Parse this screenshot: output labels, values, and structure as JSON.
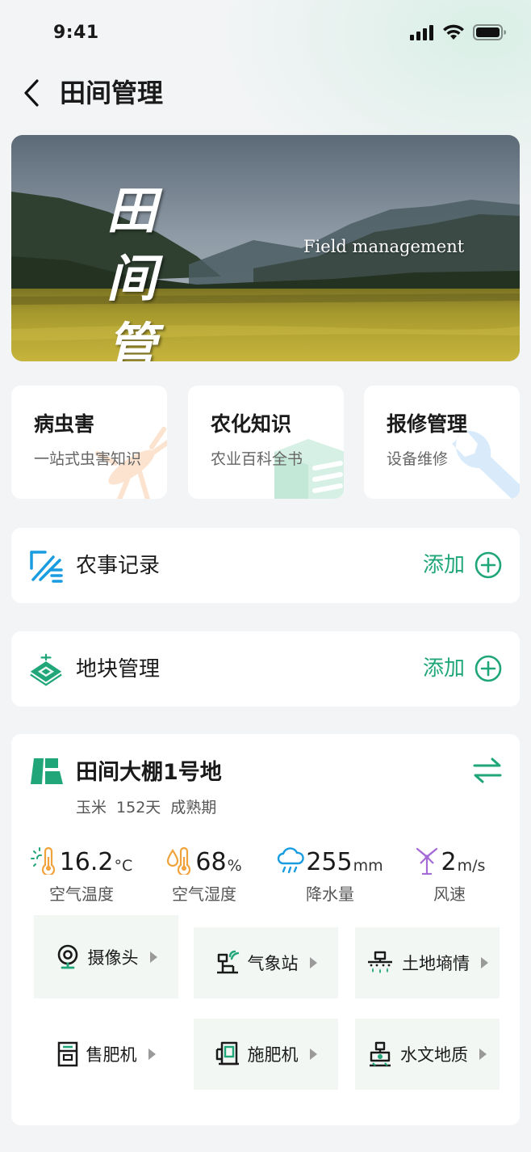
{
  "status_bar": {
    "time": "9:41"
  },
  "nav": {
    "title": "田间管理"
  },
  "banner": {
    "title_line1": "田 间",
    "title_line2": "管 理",
    "subtitle_en": "Field management"
  },
  "quick_cards": [
    {
      "title": "病虫害",
      "subtitle": "一站式虫害知识",
      "icon": "insect-icon"
    },
    {
      "title": "农化知识",
      "subtitle": "农业百科全书",
      "icon": "book-icon"
    },
    {
      "title": "报修管理",
      "subtitle": "设备维修",
      "icon": "wrench-icon"
    }
  ],
  "records": {
    "label": "农事记录",
    "add_label": "添加"
  },
  "plots_manage": {
    "label": "地块管理",
    "add_label": "添加"
  },
  "plot": {
    "name": "田间大棚1号地",
    "crop": "玉米",
    "days": "152天",
    "stage": "成熟期",
    "weather": [
      {
        "value": "16.2",
        "unit": "°C",
        "label": "空气温度",
        "icon": "thermometer-icon"
      },
      {
        "value": "68",
        "unit": "%",
        "label": "空气湿度",
        "icon": "humidity-icon"
      },
      {
        "value": "255",
        "unit": "mm",
        "label": "降水量",
        "icon": "rain-cloud-icon"
      },
      {
        "value": "2",
        "unit": "m/s",
        "label": "风速",
        "icon": "wind-turbine-icon"
      }
    ],
    "devices": [
      {
        "label": "摄像头",
        "icon": "camera-icon"
      },
      {
        "label": "气象站",
        "icon": "weather-station-icon"
      },
      {
        "label": "土地墒情",
        "icon": "soil-moisture-icon"
      },
      {
        "label": "售肥机",
        "icon": "fertilizer-vending-icon"
      },
      {
        "label": "施肥机",
        "icon": "fertilizer-machine-icon"
      },
      {
        "label": "水文地质",
        "icon": "hydrology-icon"
      }
    ]
  },
  "colors": {
    "accent": "#21a67a",
    "blue": "#1a9ce0",
    "orange": "#f0a33c",
    "purple": "#a46ad6"
  }
}
